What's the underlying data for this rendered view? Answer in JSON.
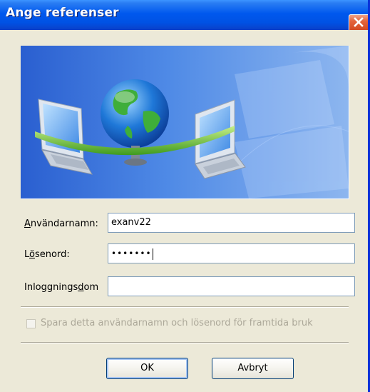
{
  "window": {
    "title": "Ange referenser",
    "close_icon": "close-icon"
  },
  "banner": {
    "image": "network-globe-laptops-illustration"
  },
  "form": {
    "username_label": "Användarnamn:",
    "username_accesskey": "A",
    "username_value": "exanv22",
    "password_label": "Lösenord:",
    "password_accesskey": "ö",
    "password_masked": "•••••••",
    "domain_label": "Inloggningsdom",
    "domain_accesskey": "d",
    "domain_value": ""
  },
  "save_checkbox": {
    "label": "Spara detta användarnamn och lösenord för framtida bruk",
    "checked": false,
    "enabled": false
  },
  "buttons": {
    "ok": "OK",
    "cancel": "Avbryt"
  },
  "colors": {
    "titlebar": "#0058ee",
    "dialog_bg": "#ece9d8",
    "close_button": "#e4653c"
  }
}
